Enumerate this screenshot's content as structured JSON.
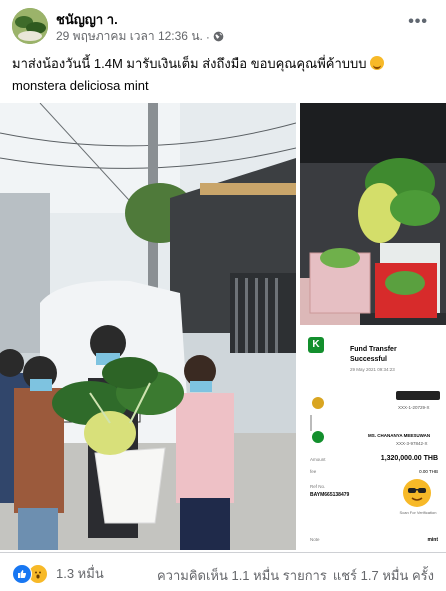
{
  "post": {
    "author": "ชนัญญา า.",
    "timestamp": "29 พฤษภาคม เวลา 12:36 น.",
    "separator": "·",
    "privacy_icon": "globe-icon",
    "more_icon": "more-icon",
    "more_label": "•••",
    "caption_line1": "มาส่งน้องวันนี้ 1.4M มารับเงินเต็ม ส่งถึงมือ ขอบคุณคุณพี่ค้าบบบ",
    "caption_emoji": "smiling-face-with-hearts-emoji",
    "caption_line2": "monstera deliciosa mint"
  },
  "receipt": {
    "logo_text": "K",
    "title": "Fund Transfer",
    "status": "Successful",
    "date": "29 May 2021 09:34:23",
    "from_account": "XXX-1-20729-X",
    "to_name": "MS. CHANANYA MEESUWAN",
    "to_account": "XXX-3-97842-X",
    "amount_label": "Amount",
    "amount": "1,320,000.00 THB",
    "fee_label": "fee",
    "fee": "0.00 THB",
    "ref_label": "Ref No.",
    "ref": "BAYM665138479",
    "verify_label": "Scan For Verification",
    "note_label": "Note",
    "note": "mint"
  },
  "footer": {
    "reaction_icons": [
      "like-icon",
      "wow-icon"
    ],
    "reaction_count": "1.3 หมื่น",
    "comments": "ความคิดเห็น 1.1 หมื่น รายการ",
    "shares": "แชร์ 1.7 หมื่น ครั้ง"
  },
  "colors": {
    "facebook_blue": "#1877f2",
    "kbank_green": "#138f2d",
    "muted_text": "#65676b"
  }
}
